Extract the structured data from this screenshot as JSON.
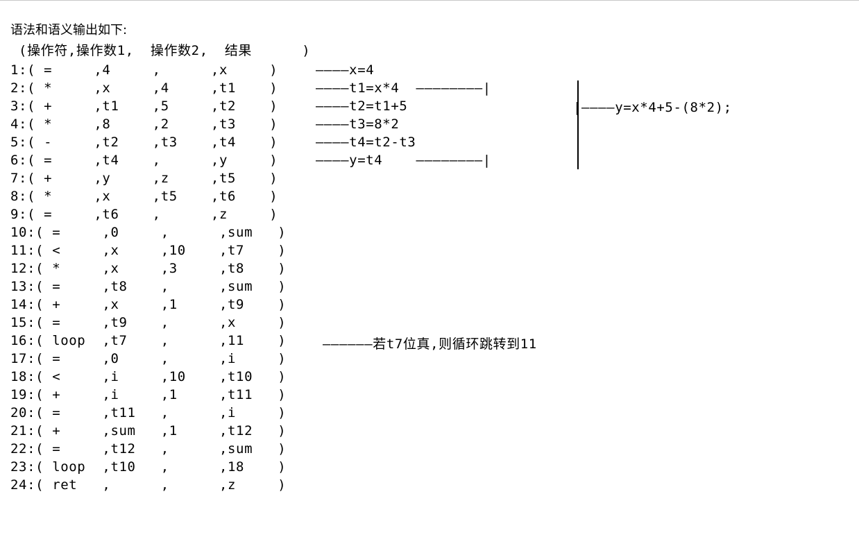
{
  "title": "语法和语义输出如下:",
  "columns_header": " (操作符,操作数1,  操作数2,  结果      )",
  "rows": [
    "1:( =     ,4     ,      ,x     )",
    "2:( *     ,x     ,4     ,t1    )",
    "3:( +     ,t1    ,5     ,t2    )",
    "4:( *     ,8     ,2     ,t3    )",
    "5:( -     ,t2    ,t3    ,t4    )",
    "6:( =     ,t4    ,      ,y     )",
    "7:( +     ,y     ,z     ,t5    )",
    "8:( *     ,x     ,t5    ,t6    )",
    "9:( =     ,t6    ,      ,z     )",
    "10:( =     ,0     ,      ,sum   )",
    "11:( <     ,x     ,10    ,t7    )",
    "12:( *     ,x     ,3     ,t8    )",
    "13:( =     ,t8    ,      ,sum   )",
    "14:( +     ,x     ,1     ,t9    )",
    "15:( =     ,t9    ,      ,x     )",
    "16:( loop  ,t7    ,      ,11    )",
    "17:( =     ,0     ,      ,i     )",
    "18:( <     ,i     ,10    ,t10   )",
    "19:( +     ,i     ,1     ,t11   )",
    "20:( =     ,t11   ,      ,i     )",
    "21:( +     ,sum   ,1     ,t12   )",
    "22:( =     ,t12   ,      ,sum   )",
    "23:( loop  ,t10   ,      ,18    )",
    "24:( ret   ,      ,      ,z     )"
  ],
  "annotations": {
    "row1": "————x=4",
    "row2": "————t1=x*4  ————————|",
    "row3": "————t2=t1+5",
    "row4": "————t3=8*2",
    "row5": "————t4=t2-t3",
    "row6": "————y=t4    ————————|",
    "expression": "|————y=x*4+5-(8*2);",
    "loop_note": "——————若t7位真,则循环跳转到11"
  }
}
